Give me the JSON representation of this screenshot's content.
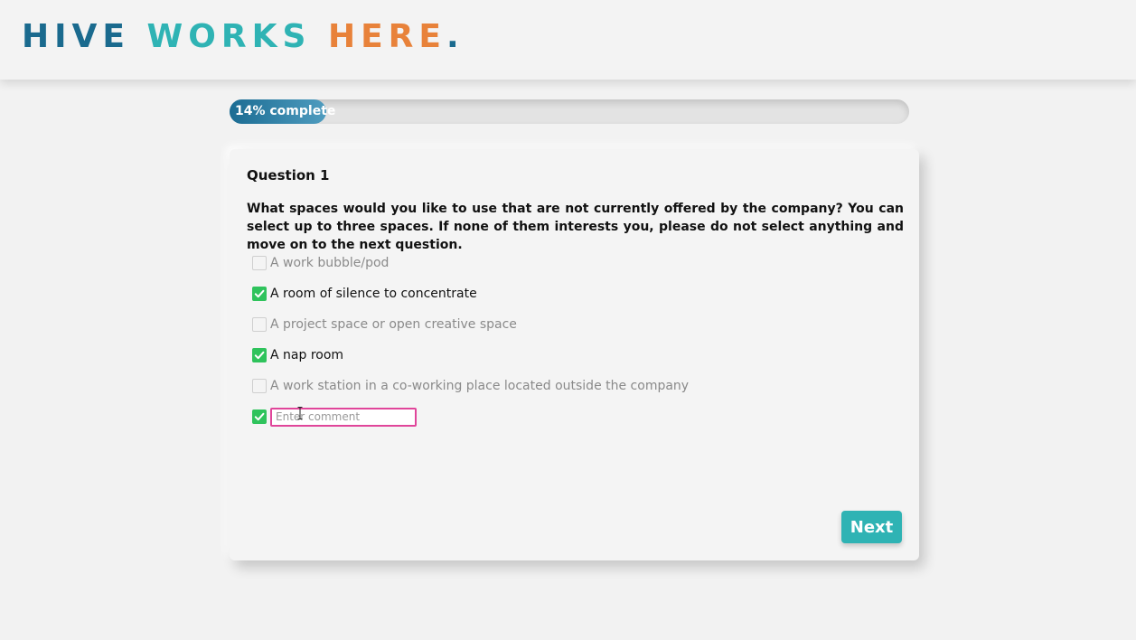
{
  "header": {
    "logo_word1": "HIVE",
    "logo_word2": "WORKS",
    "logo_word3": "HERE",
    "logo_dot": ".",
    "colors": {
      "primary": "#1a6a8e",
      "teal": "#2fb3b4",
      "orange": "#e8823a"
    }
  },
  "progress": {
    "label": "14% complete",
    "value": 0.14
  },
  "question": {
    "number_label": "Question 1",
    "text": "What spaces would you like to use that are not currently offered by the company? You can select up to three spaces. If none of them interests you, please do not select anything and move on to the next question.",
    "options": [
      {
        "label": "A work bubble/pod",
        "checked": false
      },
      {
        "label": "A room of silence to concentrate",
        "checked": true
      },
      {
        "label": "A project space or open creative space",
        "checked": false
      },
      {
        "label": "A nap room",
        "checked": true
      },
      {
        "label": "A work station in a co-working place located outside the company",
        "checked": false
      }
    ],
    "other": {
      "checked": true,
      "value": "",
      "placeholder": "Enter comment"
    }
  },
  "actions": {
    "next_label": "Next",
    "next_color": "#2fb3b4"
  },
  "check_color": "#2fc35c"
}
